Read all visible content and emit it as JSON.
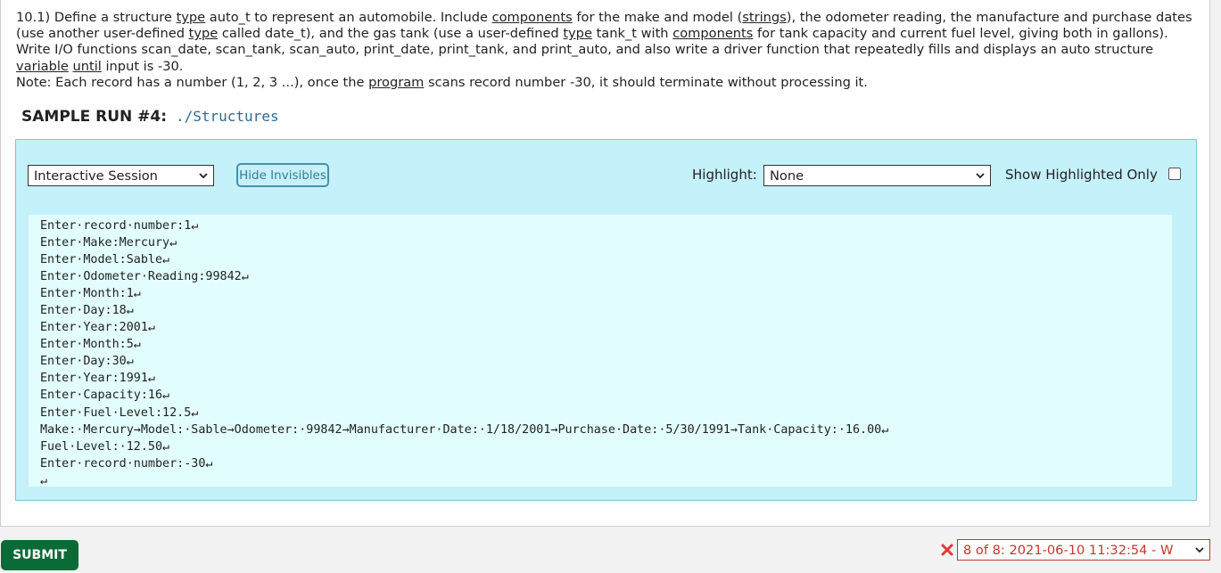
{
  "description": {
    "p1": [
      {
        "t": "10.1) Define a structure "
      },
      {
        "t": "type",
        "u": true
      },
      {
        "t": " auto_t to represent an automobile. Include "
      },
      {
        "t": "components",
        "u": true
      },
      {
        "t": " for the make and model ("
      },
      {
        "t": "strings",
        "u": true
      },
      {
        "t": "), the odometer reading, the manufacture and purchase dates (use another user-defined "
      },
      {
        "t": "type",
        "u": true
      },
      {
        "t": " called date_t), and the gas tank (use a user-defined "
      },
      {
        "t": "type",
        "u": true
      },
      {
        "t": " tank_t with "
      },
      {
        "t": "components",
        "u": true
      },
      {
        "t": " for tank capacity and current fuel level, giving both in gallons). Write I/O functions scan_date, scan_tank, scan_auto, print_date, print_tank, and print_auto, and also write a driver function that repeatedly fills and displays an auto structure "
      },
      {
        "t": "variable",
        "u": true
      },
      {
        "t": " "
      },
      {
        "t": "until",
        "u": true
      },
      {
        "t": " input is -30."
      }
    ],
    "p2": [
      {
        "t": "Note: Each record has a number (1, 2, 3 ...), once the "
      },
      {
        "t": "program",
        "u": true
      },
      {
        "t": " scans record number -30, it should terminate without processing it."
      }
    ]
  },
  "sample": {
    "title": "SAMPLE RUN #4:",
    "command": "./Structures"
  },
  "toolbar": {
    "mode_value": "Interactive Session",
    "hide_invisibles_label": "Hide Invisibles",
    "highlight_label": "Highlight:",
    "highlight_value": "None",
    "show_highlighted_label": "Show Highlighted Only",
    "show_highlighted_checked": false
  },
  "output_lines": [
    "Enter·record·number:1↵",
    "Enter·Make:Mercury↵",
    "Enter·Model:Sable↵",
    "Enter·Odometer·Reading:99842↵",
    "Enter·Month:1↵",
    "Enter·Day:18↵",
    "Enter·Year:2001↵",
    "Enter·Month:5↵",
    "Enter·Day:30↵",
    "Enter·Year:1991↵",
    "Enter·Capacity:16↵",
    "Enter·Fuel·Level:12.5↵",
    "Make:·Mercury→Model:·Sable→Odometer:·99842→Manufacturer·Date:·1/18/2001→Purchase·Date:·5/30/1991→Tank·Capacity:·16.00↵",
    "Fuel·Level:·12.50↵",
    "Enter·record·number:-30↵",
    "↵"
  ],
  "footer": {
    "submit_label": "SUBMIT",
    "attempt_value": "8 of 8: 2021-06-10 11:32:54 - W"
  },
  "colors": {
    "session_bg": "#c4f1fa",
    "output_bg": "#e2fdfd",
    "submit_bg": "#0a6b37",
    "error_red": "#c0392b",
    "command_blue": "#2d6b95"
  },
  "icons": {
    "dropdown": "chevron-down-icon",
    "fail": "x-icon"
  }
}
